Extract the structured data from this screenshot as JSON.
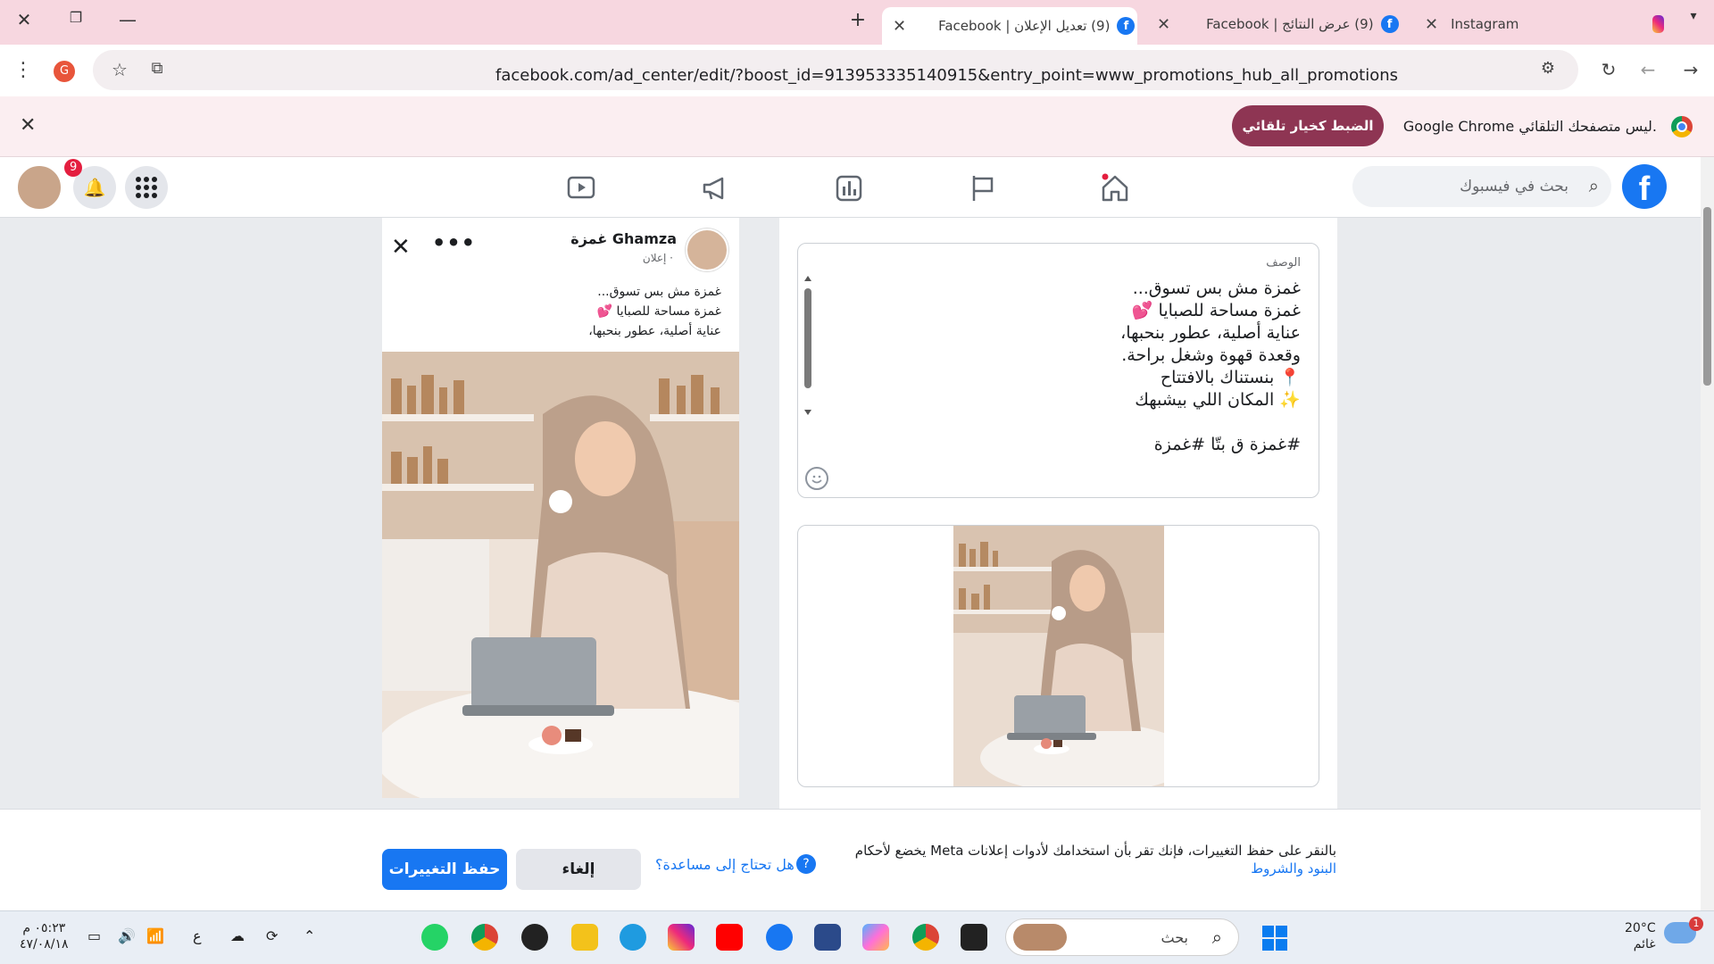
{
  "browser": {
    "tabs": [
      {
        "title": "Instagram",
        "favicon": "instagram-icon"
      },
      {
        "title": "(9) عرض النتائج | Facebook",
        "favicon": "facebook-icon"
      },
      {
        "title": "(9) تعديل الإعلان | Facebook",
        "favicon": "facebook-icon",
        "active": true
      }
    ],
    "url": "facebook.com/ad_center/edit/?boost_id=913953335140915&entry_point=www_promotions_hub_all_promotions",
    "profile_initial": "G"
  },
  "infobar": {
    "message": "Google Chrome ليس متصفحك التلقائي.",
    "button": "الضبط كخيار تلقائي"
  },
  "fb_header": {
    "search_placeholder": "بحث في فيسبوك",
    "notification_count": "9",
    "logo": "f"
  },
  "editor": {
    "description_label": "الوصف",
    "description_text": "غمزة مش بس تسوق...\nغمزة مساحة للصبايا 💕\nعناية أصلية، عطور بنحبها،\nوقعدة قهوة وشغل براحة.\n📍 بنستناك بالافتتاح\n✨ المكان اللي بيشبهك\n\n#غمزة ق بتّا #غمزة"
  },
  "preview": {
    "page_name": "غمزة Ghamza",
    "sponsored": "إعلان ·",
    "text": "غمزة مش بس تسوق...\nغمزة مساحة للصبايا 💕\nعناية أصلية، عطور بنحبها،",
    "more_label": "•••",
    "close_label": "✕"
  },
  "footer": {
    "terms_text": "بالنقر على حفظ التغييرات، فإنك تقر بأن استخدامك لأدوات إعلانات Meta يخضع لأحكام",
    "terms_link": "البنود والشروط",
    "help_text": "هل تحتاج إلى مساعدة؟",
    "cancel_label": "إلغاء",
    "save_label": "حفظ التغييرات"
  },
  "taskbar": {
    "search_placeholder": "بحث",
    "time": "٠٥:٢٣ م",
    "date": "٤٧/٠٨/١٨",
    "lang": "ع",
    "weather_temp": "20°C",
    "weather_desc": "غائم",
    "weather_badge": "1"
  },
  "colors": {
    "facebook_blue": "#1877f2",
    "chrome_tabstrip": "#f7d7e0",
    "infobar_button": "#8e3553"
  }
}
